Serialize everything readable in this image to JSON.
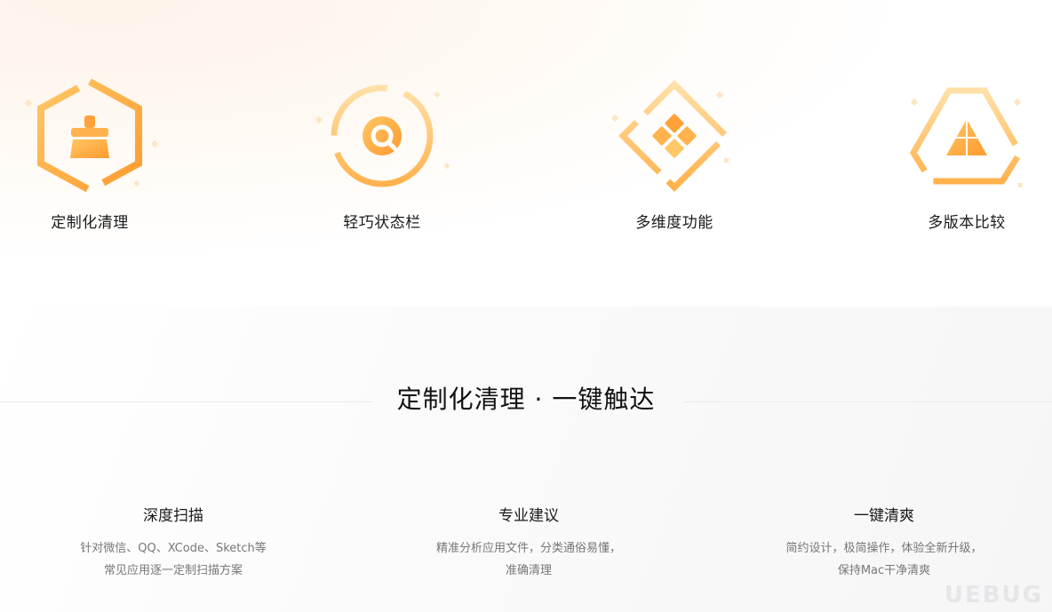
{
  "colors": {
    "accent": "#FFA23A",
    "accent_light": "#FFD08A"
  },
  "features": [
    {
      "label": "定制化清理",
      "icon": "broom-hexagon-icon"
    },
    {
      "label": "轻巧状态栏",
      "icon": "magnifier-circle-icon"
    },
    {
      "label": "多维度功能",
      "icon": "diamond-grid-icon"
    },
    {
      "label": "多版本比较",
      "icon": "triangle-layers-icon"
    }
  ],
  "section": {
    "title": "定制化清理 · 一键触达"
  },
  "points": [
    {
      "title": "深度扫描",
      "desc1": "针对微信、QQ、XCode、Sketch等",
      "desc2": "常见应用逐一定制扫描方案"
    },
    {
      "title": "专业建议",
      "desc1": "精准分析应用文件，分类通俗易懂，",
      "desc2": "准确清理"
    },
    {
      "title": "一键清爽",
      "desc1": "简约设计，极简操作，体验全新升级，",
      "desc2": "保持Mac干净清爽"
    }
  ],
  "watermark": "UEBUG"
}
